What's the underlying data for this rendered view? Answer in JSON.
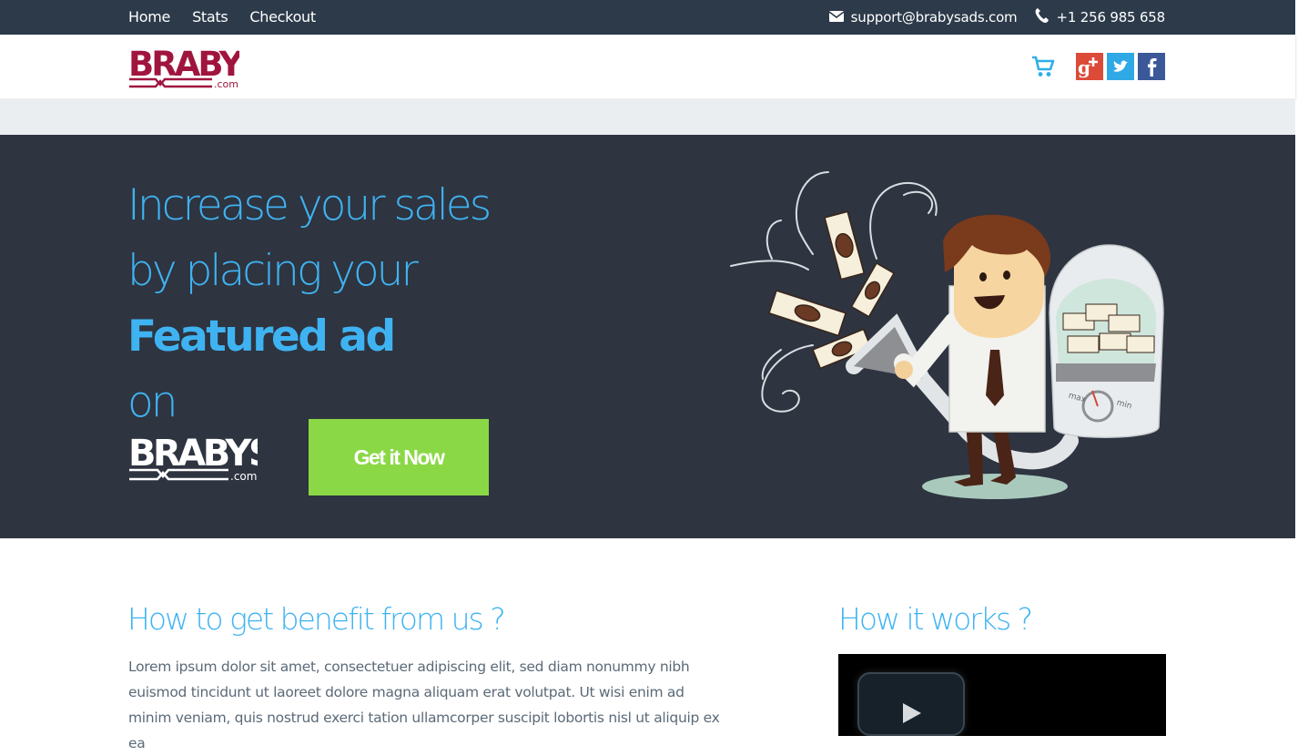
{
  "topnav": {
    "home": "Home",
    "stats": "Stats",
    "checkout": "Checkout"
  },
  "contact": {
    "email": "support@brabysads.com",
    "phone": "+1 256 985 658"
  },
  "header": {
    "logo_main": "BRABYS",
    "logo_sub": ".com"
  },
  "hero": {
    "line1": "Increase your sales",
    "line2": "by placing your",
    "line3": "Featured ad",
    "line4": "on",
    "logo_main": "BRABYS",
    "logo_sub": ".com",
    "cta": "Get it Now",
    "gauge_left": "max",
    "gauge_right": "min"
  },
  "benefit": {
    "title": "How to get benefit from us ?",
    "text": "Lorem ipsum dolor sit amet, consectetuer adipiscing elit, sed diam nonummy nibh euismod tincidunt ut laoreet dolore magna aliquam erat volutpat. Ut wisi enim ad minim veniam, quis nostrud exerci tation ullamcorper suscipit lobortis nisl ut aliquip ex ea"
  },
  "works": {
    "title": "How it works ?"
  },
  "colors": {
    "topbar": "#2c3a4a",
    "hero": "#2e3440",
    "accent": "#3fb3f2",
    "cta": "#8bd847",
    "brand": "#a0153e"
  },
  "icons": [
    "envelope-icon",
    "phone-icon",
    "cart-icon",
    "google-plus-icon",
    "twitter-icon",
    "facebook-icon",
    "play-icon"
  ]
}
